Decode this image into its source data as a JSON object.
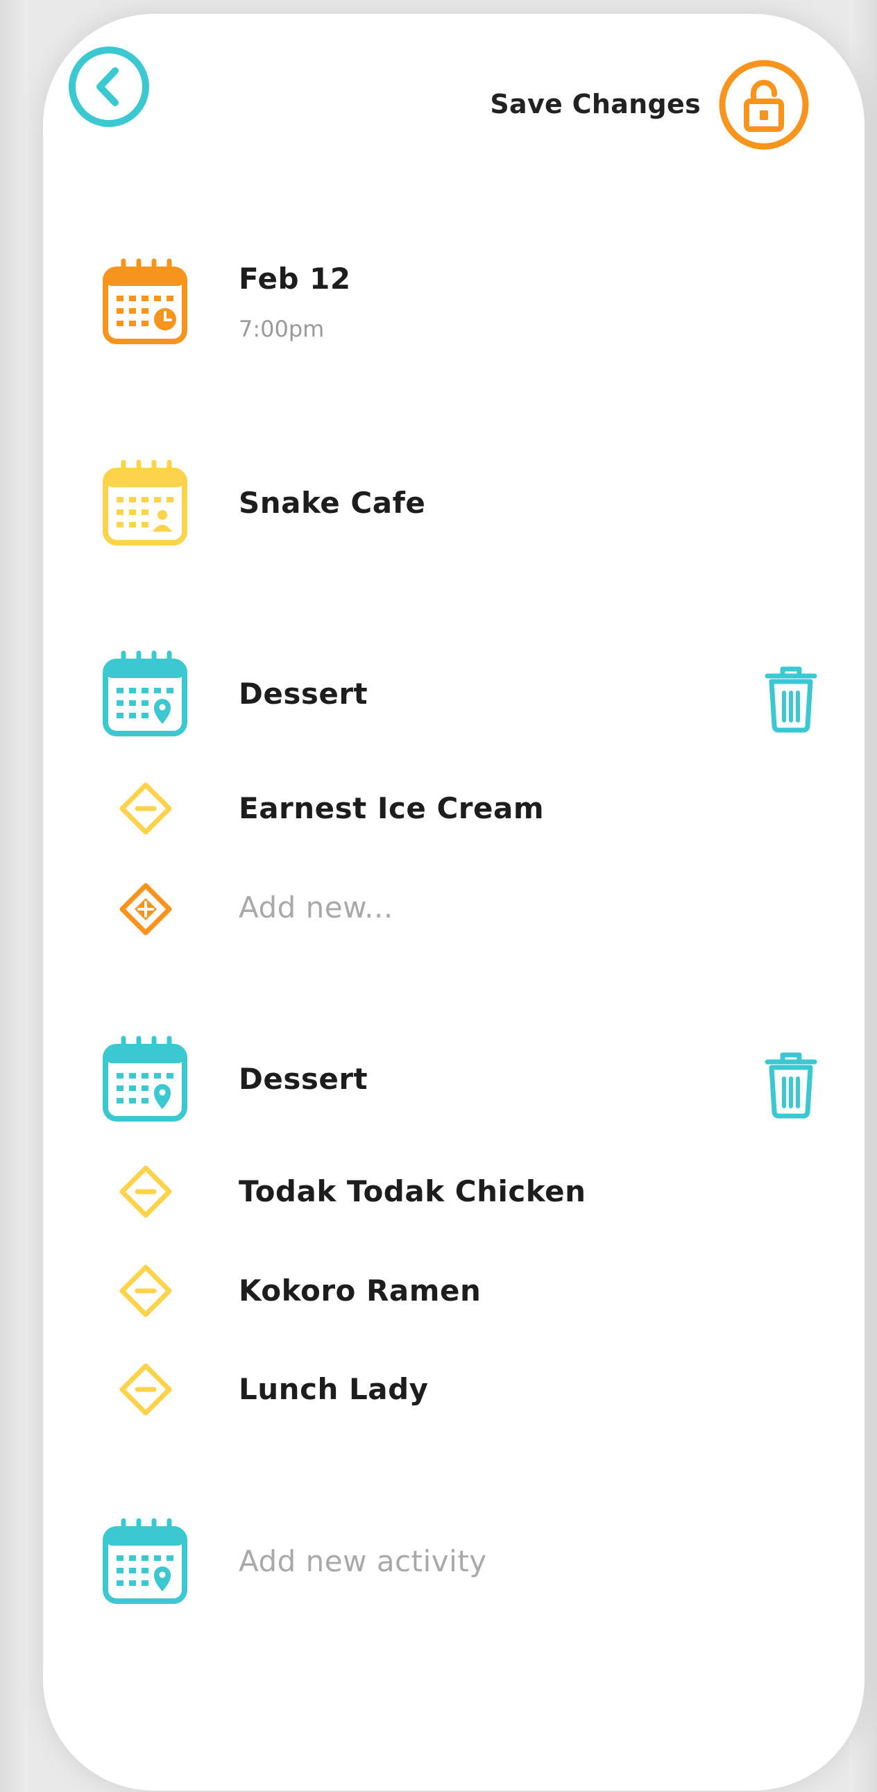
{
  "colors": {
    "teal": "#3cc8d0",
    "orange": "#f7941d",
    "yellow": "#fcd34a",
    "text": "#1d1d1d",
    "muted": "#a9a9a9"
  },
  "header": {
    "back_icon": "chevron-left-circle-icon",
    "save_label": "Save Changes",
    "lock_icon": "unlock-icon"
  },
  "event": {
    "date": "Feb 12",
    "time": "7:00pm",
    "icon": "calendar-clock-icon"
  },
  "venue": {
    "name": "Snake Cafe",
    "icon": "calendar-person-icon"
  },
  "groups": [
    {
      "title": "Dessert",
      "icon": "calendar-location-icon",
      "delete_icon": "trash-icon",
      "items": [
        {
          "label": "Earnest Ice Cream",
          "icon": "diamond-minus-icon"
        }
      ],
      "add_placeholder": "Add new..."
    },
    {
      "title": "Dessert",
      "icon": "calendar-location-icon",
      "delete_icon": "trash-icon",
      "items": [
        {
          "label": "Todak Todak Chicken",
          "icon": "diamond-minus-icon"
        },
        {
          "label": "Kokoro Ramen",
          "icon": "diamond-minus-icon"
        },
        {
          "label": "Lunch Lady",
          "icon": "diamond-minus-icon"
        }
      ]
    }
  ],
  "add_activity": {
    "label": "Add new activity",
    "icon": "calendar-location-icon"
  }
}
